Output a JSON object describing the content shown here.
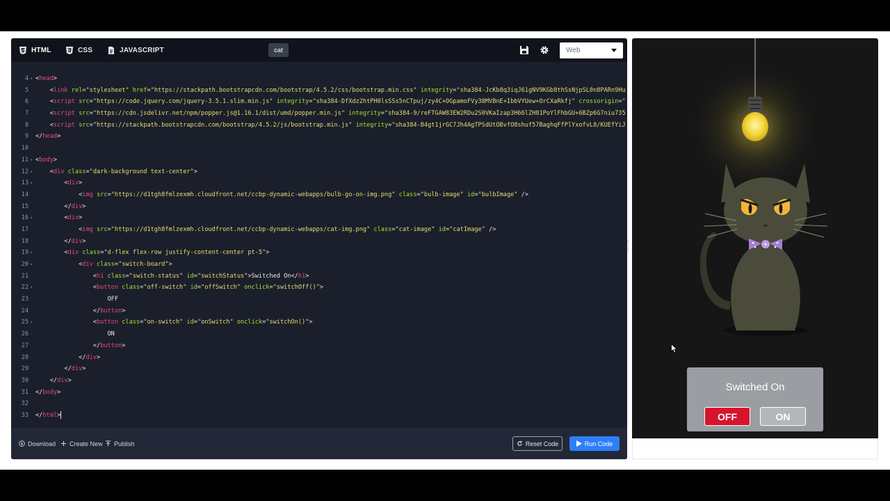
{
  "tabs": [
    {
      "label": "HTML",
      "icon": "html5-icon"
    },
    {
      "label": "CSS",
      "icon": "css3-icon"
    },
    {
      "label": "JAVASCRIPT",
      "icon": "file-icon"
    }
  ],
  "file_name": "cat",
  "view_select": {
    "value": "Web"
  },
  "code_lines": [
    {
      "n": "4",
      "fold": true,
      "html": "<span class=\"pl\">&lt;</span><span class=\"tg\">head</span><span class=\"pl\">&gt;</span>"
    },
    {
      "n": "5",
      "fold": false,
      "html": "    <span class=\"pl\">&lt;</span><span class=\"tg\">link</span> <span class=\"at\">rel</span>=<span class=\"st\">\"stylesheet\"</span> <span class=\"at\">href</span>=<span class=\"st\">\"https://stackpath.bootstrapcdn.com/bootstrap/4.5.2/css/bootstrap.min.css\"</span> <span class=\"at\">integrity</span>=<span class=\"st\">\"sha384-JcKb8q3iqJ61gNV9KGb8thSsNjpSL0n8PARn9Hu</span>"
    },
    {
      "n": "6",
      "fold": false,
      "html": "    <span class=\"pl\">&lt;</span><span class=\"tg\">script</span> <span class=\"at\">src</span>=<span class=\"st\">\"https://code.jquery.com/jquery-3.5.1.slim.min.js\"</span> <span class=\"at\">integrity</span>=<span class=\"st\">\"sha384-DfXdz2htPH0lsSSs5nCTpuj/zy4C+OGpamoFVy38MVBnE+IbbVYUew+OrCXaRkfj\"</span> <span class=\"at\">crossorigin</span>=<span class=\"st\">\"</span>"
    },
    {
      "n": "7",
      "fold": false,
      "html": "    <span class=\"pl\">&lt;</span><span class=\"tg\">script</span> <span class=\"at\">src</span>=<span class=\"st\">\"https://cdn.jsdelivr.net/npm/popper.js@1.16.1/dist/umd/popper.min.js\"</span> <span class=\"at\">integrity</span>=<span class=\"st\">\"sha384-9/reFTGAW83EW2RDu2S0VKaIzap3H66lZH81PoYlFhbGU+6BZp6G7niu735</span>"
    },
    {
      "n": "8",
      "fold": false,
      "html": "    <span class=\"pl\">&lt;</span><span class=\"tg\">script</span> <span class=\"at\">src</span>=<span class=\"st\">\"https://stackpath.bootstrapcdn.com/bootstrap/4.5.2/js/bootstrap.min.js\"</span> <span class=\"at\">integrity</span>=<span class=\"st\">\"sha384-B4gt1jrGC7Jh4AgTPSdUtOBvfO8shuf57BaghqFfPlYxofvL8/KUEfYiJ</span>"
    },
    {
      "n": "9",
      "fold": false,
      "html": "<span class=\"pl\">&lt;/</span><span class=\"tg\">head</span><span class=\"pl\">&gt;</span>"
    },
    {
      "n": "10",
      "fold": false,
      "html": ""
    },
    {
      "n": "11",
      "fold": true,
      "html": "<span class=\"pl\">&lt;</span><span class=\"tg\">body</span><span class=\"pl\">&gt;</span>"
    },
    {
      "n": "12",
      "fold": true,
      "html": "    <span class=\"pl\">&lt;</span><span class=\"tg\">div</span> <span class=\"at\">class</span>=<span class=\"st\">\"dark-background text-center\"</span><span class=\"pl\">&gt;</span>"
    },
    {
      "n": "13",
      "fold": true,
      "html": "        <span class=\"pl\">&lt;</span><span class=\"tg\">div</span><span class=\"pl\">&gt;</span>"
    },
    {
      "n": "14",
      "fold": false,
      "html": "            <span class=\"pl\">&lt;</span><span class=\"tg\">img</span> <span class=\"at\">src</span>=<span class=\"st\">\"https://d1tgh8fmlzexmh.cloudfront.net/ccbp-dynamic-webapps/bulb-go-on-img.png\"</span> <span class=\"at\">class</span>=<span class=\"st\">\"bulb-image\"</span> <span class=\"at\">id</span>=<span class=\"st\">\"bulbImage\"</span> <span class=\"pl\">/&gt;</span>"
    },
    {
      "n": "15",
      "fold": false,
      "html": "        <span class=\"pl\">&lt;/</span><span class=\"tg\">div</span><span class=\"pl\">&gt;</span>"
    },
    {
      "n": "16",
      "fold": true,
      "html": "        <span class=\"pl\">&lt;</span><span class=\"tg\">div</span><span class=\"pl\">&gt;</span>"
    },
    {
      "n": "17",
      "fold": false,
      "html": "            <span class=\"pl\">&lt;</span><span class=\"tg\">img</span> <span class=\"at\">src</span>=<span class=\"st\">\"https://d1tgh8fmlzexmh.cloudfront.net/ccbp-dynamic-webapps/cat-img.png\"</span> <span class=\"at\">class</span>=<span class=\"st\">\"cat-image\"</span> <span class=\"at\">id</span>=<span class=\"st\">\"catImage\"</span> <span class=\"pl\">/&gt;</span>"
    },
    {
      "n": "18",
      "fold": false,
      "html": "        <span class=\"pl\">&lt;/</span><span class=\"tg\">div</span><span class=\"pl\">&gt;</span>"
    },
    {
      "n": "19",
      "fold": true,
      "html": "        <span class=\"pl\">&lt;</span><span class=\"tg\">div</span> <span class=\"at\">class</span>=<span class=\"st\">\"d-flex flex-row justify-content-center pt-5\"</span><span class=\"pl\">&gt;</span>"
    },
    {
      "n": "20",
      "fold": true,
      "html": "            <span class=\"pl\">&lt;</span><span class=\"tg\">div</span> <span class=\"at\">class</span>=<span class=\"st\">\"switch-board\"</span><span class=\"pl\">&gt;</span>"
    },
    {
      "n": "21",
      "fold": false,
      "html": "                <span class=\"pl\">&lt;</span><span class=\"tg\">h1</span> <span class=\"at\">class</span>=<span class=\"st\">\"switch-status\"</span> <span class=\"at\">id</span>=<span class=\"st\">\"switchStatus\"</span><span class=\"pl\">&gt;Switched On&lt;/</span><span class=\"tg\">h1</span><span class=\"pl\">&gt;</span>"
    },
    {
      "n": "22",
      "fold": true,
      "html": "                <span class=\"pl\">&lt;</span><span class=\"tg\">button</span> <span class=\"at\">class</span>=<span class=\"st\">\"off-switch\"</span> <span class=\"at\">id</span>=<span class=\"st\">\"offSwitch\"</span> <span class=\"at\">onclick</span>=<span class=\"st\">\"switchOff()\"</span><span class=\"pl\">&gt;</span>"
    },
    {
      "n": "23",
      "fold": false,
      "html": "                    <span class=\"pl\">OFF</span>"
    },
    {
      "n": "24",
      "fold": false,
      "html": "                <span class=\"pl\">&lt;/</span><span class=\"tg\">button</span><span class=\"pl\">&gt;</span>"
    },
    {
      "n": "25",
      "fold": true,
      "html": "                <span class=\"pl\">&lt;</span><span class=\"tg\">button</span> <span class=\"at\">class</span>=<span class=\"st\">\"on-switch\"</span> <span class=\"at\">id</span>=<span class=\"st\">\"onSwitch\"</span> <span class=\"at\">onclick</span>=<span class=\"st\">\"switchOn()\"</span><span class=\"pl\">&gt;</span>"
    },
    {
      "n": "26",
      "fold": false,
      "html": "                    <span class=\"pl\">ON</span>"
    },
    {
      "n": "27",
      "fold": false,
      "html": "                <span class=\"pl\">&lt;/</span><span class=\"tg\">button</span><span class=\"pl\">&gt;</span>"
    },
    {
      "n": "28",
      "fold": false,
      "html": "            <span class=\"pl\">&lt;/</span><span class=\"tg\">div</span><span class=\"pl\">&gt;</span>"
    },
    {
      "n": "29",
      "fold": false,
      "html": "        <span class=\"pl\">&lt;/</span><span class=\"tg\">div</span><span class=\"pl\">&gt;</span>"
    },
    {
      "n": "30",
      "fold": false,
      "html": "    <span class=\"pl\">&lt;/</span><span class=\"tg\">div</span><span class=\"pl\">&gt;</span>"
    },
    {
      "n": "31",
      "fold": false,
      "html": "<span class=\"pl\">&lt;/</span><span class=\"tg\">body</span><span class=\"pl\">&gt;</span>"
    },
    {
      "n": "32",
      "fold": false,
      "html": ""
    },
    {
      "n": "33",
      "fold": false,
      "html": "<span class=\"pl\">&lt;/</span><span class=\"tg\">html</span><span class=\"pl\">&gt;</span><span class=\"cursor\"></span>"
    }
  ],
  "footer": {
    "download": "Download",
    "create_new": "Create New",
    "publish": "Publish",
    "reset": "Reset Code",
    "run": "Run Code"
  },
  "preview": {
    "status": "Switched On",
    "off_label": "OFF",
    "on_label": "ON"
  },
  "colors": {
    "editor_bg": "#1b1f2b",
    "run_button": "#2d7ff9",
    "off_button": "#d6142c",
    "tag": "#e74a7a",
    "attr": "#a6e22e",
    "string": "#e6db74"
  }
}
